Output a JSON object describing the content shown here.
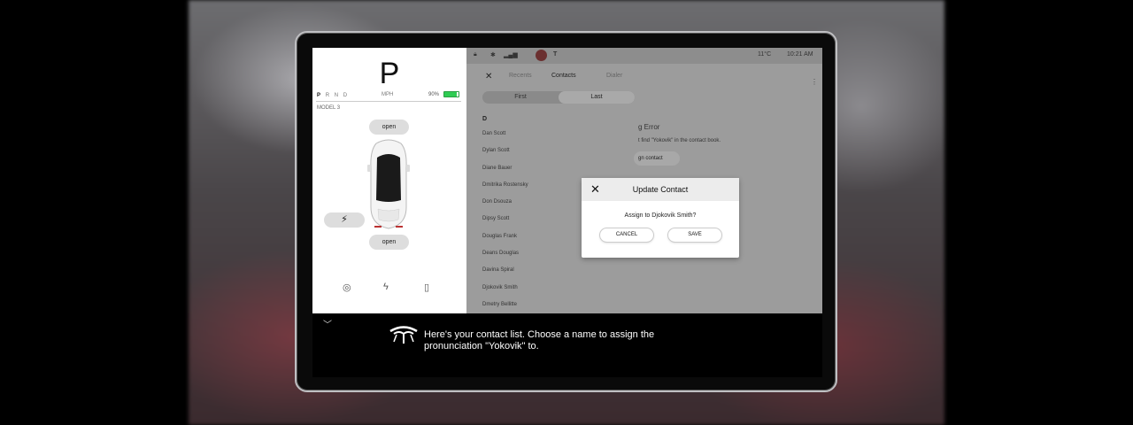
{
  "vehicle": {
    "gear": "P",
    "gears": [
      "P",
      "R",
      "N",
      "D"
    ],
    "speed_unit": "MPH",
    "battery_percent": "90%",
    "battery_level": 0.9,
    "model": "MODEL 3",
    "frunk_label": "open",
    "trunk_label": "open",
    "charge_icon": "lightning-icon",
    "bottom_icons": [
      "tire-pressure-icon",
      "energy-icon",
      "phone-key-icon"
    ]
  },
  "status_bar": {
    "temperature": "11°C",
    "time": "10:21 AM",
    "icons": [
      "lock-icon",
      "bluetooth-icon",
      "cellular-icon",
      "app-icon",
      "logo-icon"
    ]
  },
  "phone": {
    "tabs": [
      "Recents",
      "Contacts",
      "Dialer"
    ],
    "active_tab": "Contacts",
    "sort": {
      "first": "First",
      "last": "Last",
      "selected": "Last"
    },
    "section": "D",
    "contacts": [
      "Dan Scott",
      "Dylan Scott",
      "Diane Bauer",
      "Dmitrika Rostensky",
      "Don Dsouza",
      "Dipsy Scott",
      "Douglas Frank",
      "Deans Douglas",
      "Davina Spiral",
      "Djokovik Smith",
      "Dmetry Bellitte"
    ]
  },
  "error_panel": {
    "title": "g Error",
    "message": "t find \"Yokovik\" in the contact book.",
    "button_label": "gn contact"
  },
  "modal": {
    "title": "Update Contact",
    "body": "Assign to Djokovik Smith?",
    "cancel": "CANCEL",
    "save": "SAVE"
  },
  "voice": {
    "message": "Here's your contact list. Choose a name to assign the pronunciation \"Yokovik\" to."
  }
}
